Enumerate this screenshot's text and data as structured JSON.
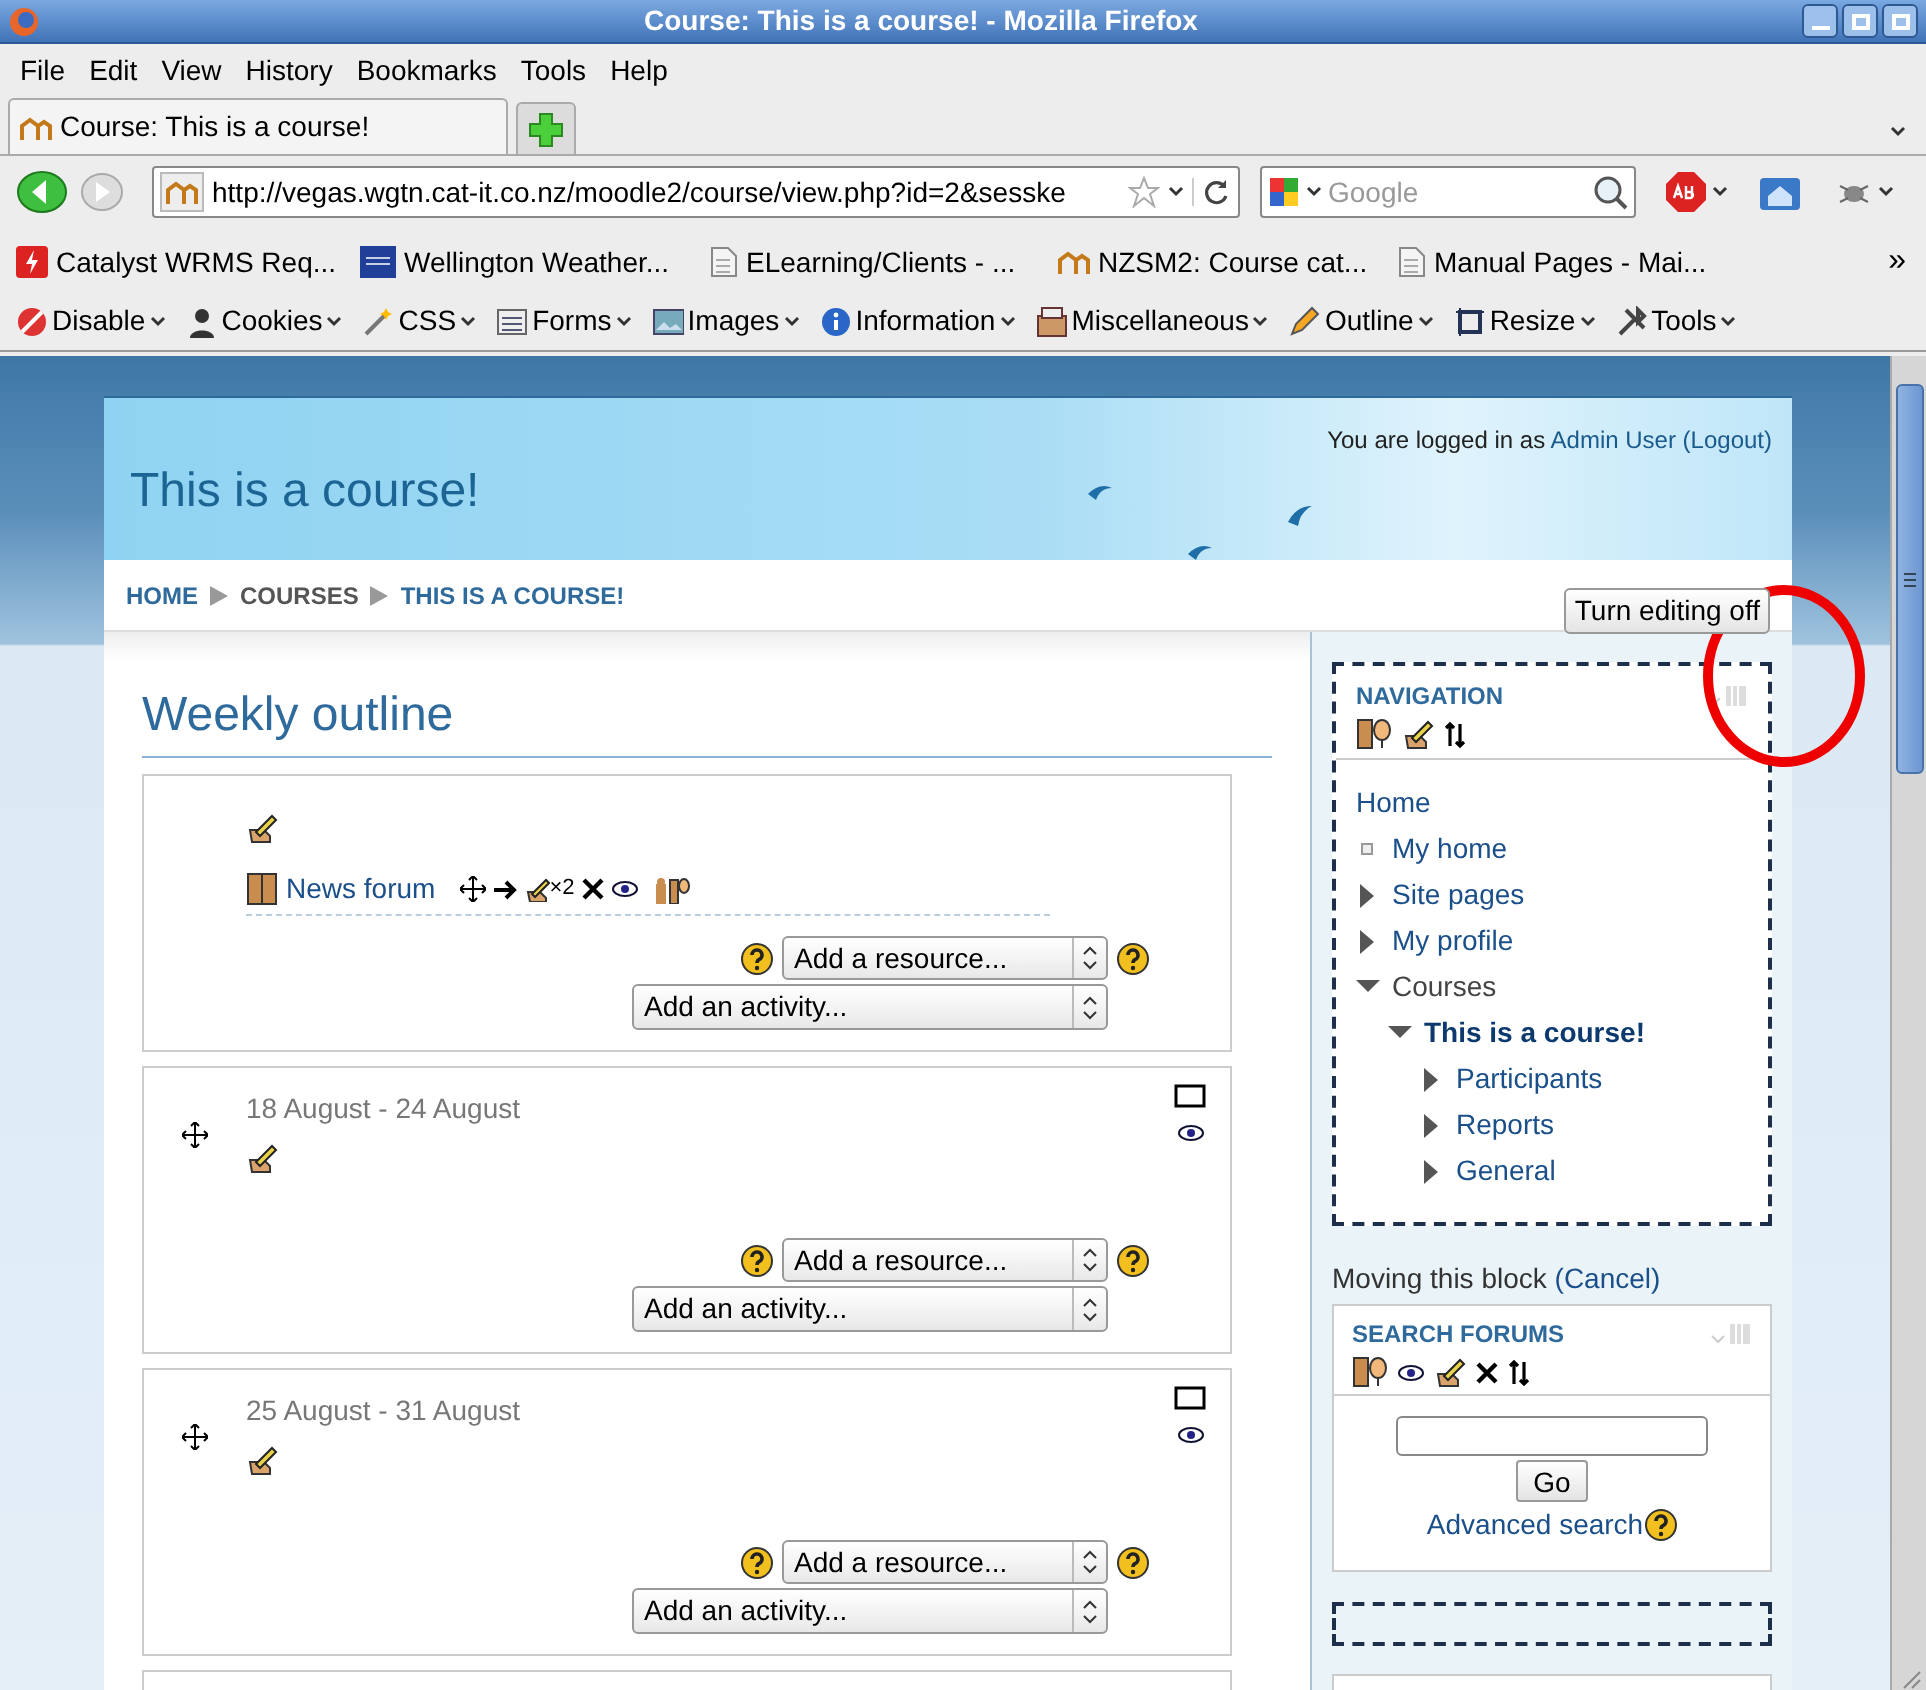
{
  "window": {
    "title": "Course: This is a course! - Mozilla Firefox"
  },
  "menu": [
    "File",
    "Edit",
    "View",
    "History",
    "Bookmarks",
    "Tools",
    "Help"
  ],
  "tabs": [
    {
      "label": "Course: This is a course!",
      "selected": true
    }
  ],
  "address_bar": {
    "url": "http://vegas.wgtn.cat-it.co.nz/moodle2/course/view.php?id=2&sesske"
  },
  "search_bar": {
    "placeholder": "Google"
  },
  "bookmarks": {
    "items": [
      "Catalyst WRMS Req...",
      "Wellington Weather...",
      "ELearning/Clients - ...",
      "NZSM2: Course cat...",
      "Manual Pages - Mai..."
    ],
    "overflow": "»"
  },
  "webdev_toolbar": [
    "Disable",
    "Cookies",
    "CSS",
    "Forms",
    "Images",
    "Information",
    "Miscellaneous",
    "Outline",
    "Resize",
    "Tools"
  ],
  "page": {
    "login_info": {
      "text": "You are logged in as",
      "user": "Admin User",
      "logout": "(Logout)"
    },
    "course_title": "This is a course!",
    "breadcrumb": [
      "HOME",
      "COURSES",
      "THIS IS A COURSE!"
    ],
    "editing_button": "Turn editing off",
    "outline_title": "Weekly outline",
    "sections": [
      {
        "activities": [
          {
            "name": "News forum",
            "controls_text": "×2"
          }
        ],
        "resource_select": "Add a resource...",
        "activity_select": "Add an activity..."
      },
      {
        "title": "18 August - 24 August",
        "resource_select": "Add a resource...",
        "activity_select": "Add an activity..."
      },
      {
        "title": "25 August - 31 August",
        "resource_select": "Add a resource...",
        "activity_select": "Add an activity..."
      }
    ],
    "navigation_block": {
      "title": "NAVIGATION",
      "moving": true,
      "home": "Home",
      "tree": [
        {
          "label": "My home",
          "kind": "leaf",
          "current": false
        },
        {
          "label": "Site pages",
          "kind": "branch",
          "expanded": false,
          "current": false
        },
        {
          "label": "My profile",
          "kind": "branch",
          "expanded": false,
          "current": false
        },
        {
          "label": "Courses",
          "kind": "branch",
          "expanded": true,
          "current": false,
          "children": [
            {
              "label": "This is a course!",
              "kind": "branch",
              "expanded": true,
              "current": true,
              "children": [
                {
                  "label": "Participants",
                  "kind": "branch",
                  "expanded": false,
                  "current": false
                },
                {
                  "label": "Reports",
                  "kind": "branch",
                  "expanded": false,
                  "current": false
                },
                {
                  "label": "General",
                  "kind": "branch",
                  "expanded": false,
                  "current": false
                }
              ]
            }
          ]
        }
      ]
    },
    "moving_notice": {
      "text": "Moving this block",
      "cancel": "(Cancel)"
    },
    "search_block": {
      "title": "SEARCH FORUMS",
      "moving": false,
      "button": "Go",
      "advanced_link": "Advanced search"
    }
  }
}
